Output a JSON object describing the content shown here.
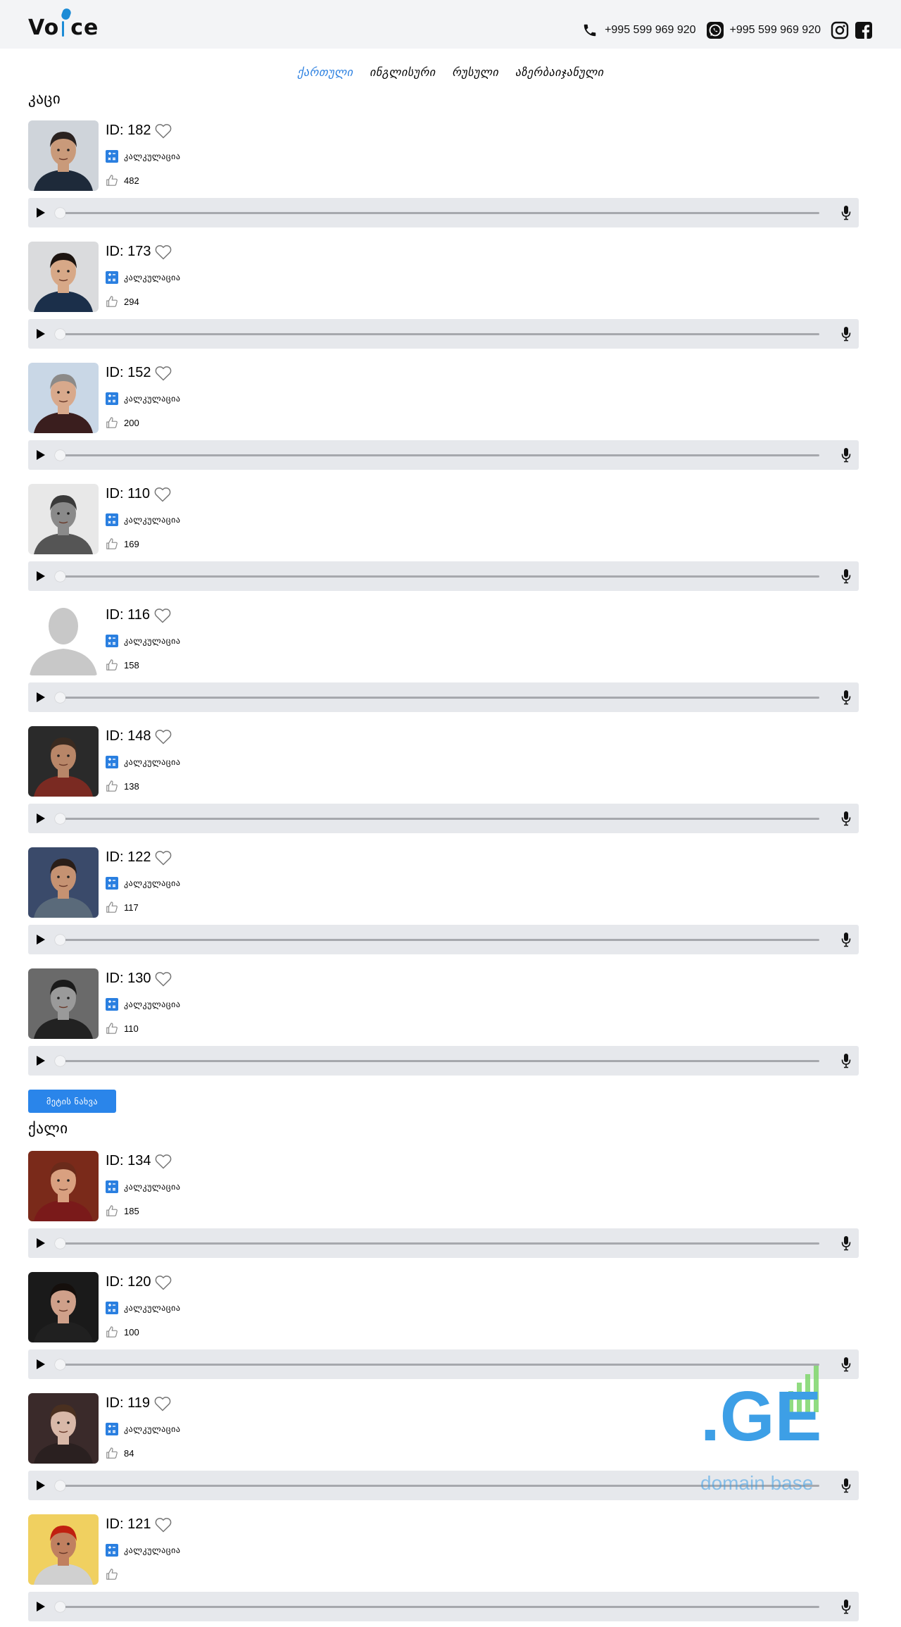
{
  "header": {
    "logo_left": "Vo",
    "logo_right": "ce",
    "phone": "+995 599 969 920",
    "whatsapp": "+995 599 969 920",
    "icons": [
      "phone-icon",
      "whatsapp-icon",
      "instagram-icon",
      "facebook-icon"
    ]
  },
  "nav": {
    "items": [
      "ქართული",
      "ინგლისური",
      "რუსული",
      "აზერბაიჯანული"
    ],
    "active": 0
  },
  "sections": {
    "male_title": "კაცი",
    "female_title": "ქალი",
    "more_label": "მეტის ნახვა"
  },
  "calc_label": "კალკულაცია",
  "male_cards": [
    {
      "id": "ID: 182",
      "likes": "482"
    },
    {
      "id": "ID: 173",
      "likes": "294"
    },
    {
      "id": "ID: 152",
      "likes": "200"
    },
    {
      "id": "ID: 110",
      "likes": "169"
    },
    {
      "id": "ID: 116",
      "likes": "158"
    },
    {
      "id": "ID: 148",
      "likes": "138"
    },
    {
      "id": "ID: 122",
      "likes": "117"
    },
    {
      "id": "ID: 130",
      "likes": "110"
    }
  ],
  "female_cards": [
    {
      "id": "ID: 134",
      "likes": "185"
    },
    {
      "id": "ID: 120",
      "likes": "100"
    },
    {
      "id": "ID: 119",
      "likes": "84"
    },
    {
      "id": "ID: 121",
      "likes": ""
    }
  ],
  "watermark": {
    "big": ".GE",
    "small": "domain base"
  },
  "colors": {
    "accent": "#2a7fe0",
    "button": "#2a85ea",
    "player_bg": "#e6e8ec",
    "header_bg": "#f3f4f6"
  }
}
